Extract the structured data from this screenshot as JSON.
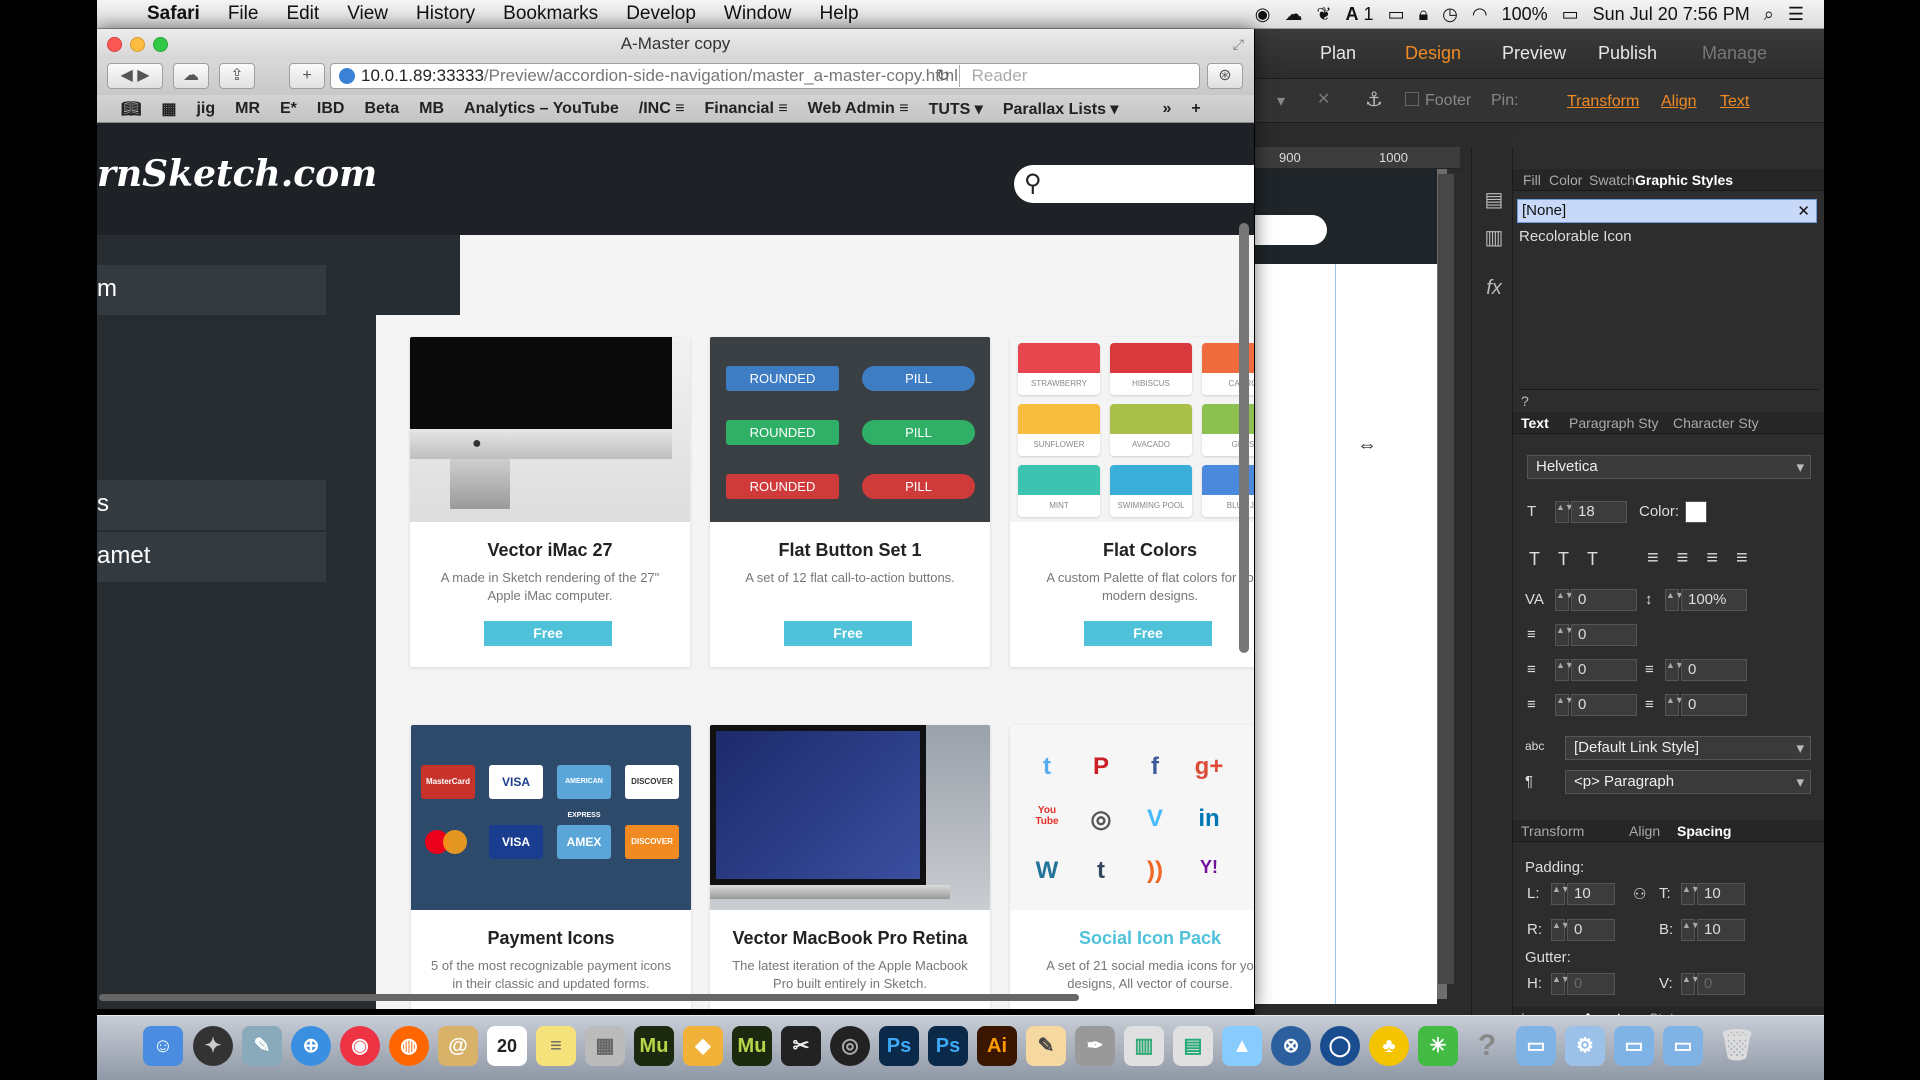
{
  "menubar": {
    "apple": "",
    "app": "Safari",
    "items": [
      "File",
      "Edit",
      "View",
      "History",
      "Bookmarks",
      "Develop",
      "Window",
      "Help"
    ],
    "status": {
      "adobe": "A",
      "one": "1",
      "battery": "100%",
      "clock": "Sun Jul 20  7:56 PM"
    }
  },
  "muse": {
    "modes": [
      "Plan",
      "Design",
      "Preview",
      "Publish",
      "Manage"
    ],
    "toolbar": {
      "footer": "Footer",
      "pin": "Pin:",
      "transform": "Transform",
      "align": "Align",
      "text": "Text"
    },
    "ruler": [
      "900",
      "1000"
    ],
    "panel": {
      "tabs1": [
        "Fill",
        "Color",
        "Swatch",
        "Graphic Styles"
      ],
      "styles": [
        "[None]",
        "Recolorable Icon"
      ],
      "tabs2": [
        "Text",
        "Paragraph Sty",
        "Character Sty"
      ],
      "font": "Helvetica",
      "size": "18",
      "color_label": "Color:",
      "tracking": "0",
      "leading": "100%",
      "indent1": "0",
      "indent2": "0",
      "indent3": "0",
      "space_before": "0",
      "space_after": "0",
      "link_style": "[Default Link Style]",
      "paragraph": "<p> Paragraph",
      "tabs3": [
        "Transform",
        "Align",
        "Spacing"
      ],
      "padding_label": "Padding:",
      "pad_l": "L:",
      "pad_l_val": "10",
      "pad_t": "T:",
      "pad_t_val": "10",
      "pad_r": "R:",
      "pad_r_val": "0",
      "pad_b": "B:",
      "pad_b_val": "10",
      "gutter_label": "Gutter:",
      "gutter_h": "H:",
      "gutter_h_val": "0",
      "gutter_v": "V:",
      "gutter_v_val": "0",
      "tabs4": [
        "Layers",
        "Assets",
        "States"
      ]
    }
  },
  "safari": {
    "title": "A-Master copy",
    "url_host": "10.0.1.89:33333",
    "url_path": "/Preview/accordion-side-navigation/master_a-master-copy.html",
    "reader": "Reader",
    "bookmarks": [
      "jig",
      "MR",
      "E*",
      "IBD",
      "Beta",
      "MB",
      "Analytics – YouTube",
      "/INC ≡",
      "Financial ≡",
      "Web Admin ≡",
      "TUTS ▾",
      "Parallax Lists ▾"
    ]
  },
  "page": {
    "logo": "rnSketch.com",
    "side": [
      "m",
      "s",
      "amet"
    ],
    "cards": [
      {
        "title": "Vector iMac 27",
        "desc": "A made in Sketch rendering of the 27\" Apple iMac computer.",
        "btn": "Free"
      },
      {
        "title": "Flat Button Set 1",
        "desc": "A set of 12 flat call-to-action buttons.",
        "btn": "Free"
      },
      {
        "title": "Flat Colors",
        "desc": "A custom Palette of flat colors for yo modern designs.",
        "btn": "Free"
      },
      {
        "title": "Payment Icons",
        "desc": "5 of the most recognizable payment icons in their classic and updated forms.",
        "btn": ""
      },
      {
        "title": "Vector MacBook Pro Retina",
        "desc": "The latest iteration of the Apple Macbook Pro built entirely in Sketch.",
        "btn": ""
      },
      {
        "title": "Social Icon Pack",
        "desc": "A set of 21 social media icons for yo designs, All vector of course.",
        "btn": ""
      }
    ],
    "flat_buttons": [
      "ROUNDED",
      "PILL",
      "ROUNDED",
      "PILL",
      "ROUNDED",
      "PILL"
    ],
    "swatches": [
      "STRAWBERRY",
      "HIBISCUS",
      "CARRO",
      "SUNFLOWER",
      "AVACADO",
      "GRAS",
      "MINT",
      "SWIMMING POOL",
      "BLUE JE"
    ],
    "payment": [
      "MasterCard",
      "VISA",
      "AMERICAN EXPRESS",
      "DISCOVER",
      "",
      "VISA",
      "AMEX",
      "DISCOVER"
    ],
    "social": [
      "t",
      "P",
      "f",
      "g+",
      "You Tube",
      "◎",
      "V",
      "in",
      "W",
      "t",
      "))",
      "Y!"
    ]
  },
  "dock": {
    "calendar_day": "20",
    "mu": "Mu",
    "ps": "Ps",
    "ai": "Ai"
  },
  "colors": {
    "accent": "#f08a24",
    "free_btn": "#4fc1d9",
    "page_dark": "#272c30"
  }
}
